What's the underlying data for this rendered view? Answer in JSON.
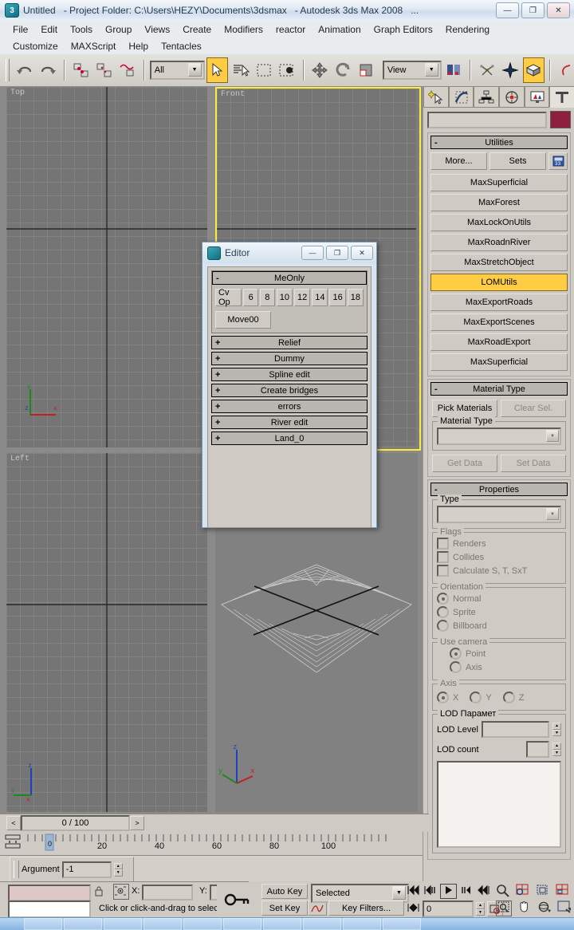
{
  "titlebar": {
    "file_name": "Untitled",
    "project": "- Project Folder: C:\\Users\\HEZY\\Documents\\3dsmax",
    "app": "- Autodesk 3ds Max 2008",
    "ellipsis": "...",
    "minimize": "—",
    "restore": "❐",
    "close": "✕"
  },
  "menu": {
    "row1": [
      "File",
      "Edit",
      "Tools",
      "Group",
      "Views",
      "Create",
      "Modifiers",
      "reactor",
      "Animation",
      "Graph Editors",
      "Rendering"
    ],
    "row2": [
      "Customize",
      "MAXScript",
      "Help",
      "Tentacles"
    ]
  },
  "toolbar": {
    "selection_filter": "All",
    "reference_coord": "View",
    "icons": [
      "undo-icon",
      "redo-icon",
      "select-link-icon",
      "unlink-icon",
      "bind-space-warp-icon",
      "select-object-icon",
      "select-by-name-icon",
      "rect-select-region-icon",
      "window-crossing-icon",
      "select-move-icon",
      "select-rotate-icon",
      "select-scale-icon",
      "use-pivot-center-icon",
      "mirror-icon",
      "align-icon",
      "layer-manager-icon",
      "curve-editor-icon"
    ]
  },
  "viewports": [
    {
      "label": "Top",
      "active": false
    },
    {
      "label": "Front",
      "active": true
    },
    {
      "label": "Left",
      "active": false
    },
    {
      "label": "",
      "active": false
    }
  ],
  "editor_dialog": {
    "title": "Editor",
    "minimize": "—",
    "restore": "❐",
    "close": "✕",
    "rollup_open": {
      "label": "MeOnly",
      "sign": "-",
      "buttons": [
        "Cv Op",
        "6",
        "8",
        "10",
        "12",
        "14",
        "16",
        "18"
      ],
      "move_button": "Move00"
    },
    "rollups": [
      {
        "sign": "+",
        "label": "Relief"
      },
      {
        "sign": "+",
        "label": "Dummy"
      },
      {
        "sign": "+",
        "label": "Spline edit"
      },
      {
        "sign": "+",
        "label": "Create bridges"
      },
      {
        "sign": "+",
        "label": "errors"
      },
      {
        "sign": "+",
        "label": "River edit"
      },
      {
        "sign": "+",
        "label": "Land_0"
      }
    ]
  },
  "command_panel": {
    "tabs": [
      "create-tab-icon",
      "modify-tab-icon",
      "hierarchy-tab-icon",
      "motion-tab-icon",
      "display-tab-icon",
      "utilities-tab-icon"
    ],
    "object_name": "",
    "object_color": "#8f1f3f",
    "utilities": {
      "sign": "-",
      "title": "Utilities",
      "more_button": "More...",
      "sets_button": "Sets",
      "config_icon": "configure-button-sets-icon",
      "buttons": [
        {
          "label": "MaxSuperficial",
          "selected": false
        },
        {
          "label": "MaxForest",
          "selected": false
        },
        {
          "label": "MaxLockOnUtils",
          "selected": false
        },
        {
          "label": "MaxRoadnRiver",
          "selected": false
        },
        {
          "label": "MaxStretchObject",
          "selected": false
        },
        {
          "label": "LOMUtils",
          "selected": true
        },
        {
          "label": "MaxExportRoads",
          "selected": false
        },
        {
          "label": "MaxExportScenes",
          "selected": false
        },
        {
          "label": "MaxRoadExport",
          "selected": false
        },
        {
          "label": "MaxSuperficial",
          "selected": false
        }
      ]
    },
    "material_type": {
      "sign": "-",
      "title": "Material Type",
      "pick_materials": "Pick Materials",
      "clear_sel": "Clear Sel.",
      "group_label": "Material Type",
      "combo_value": "",
      "get_data": "Get Data",
      "set_data": "Set Data"
    },
    "properties": {
      "sign": "-",
      "title": "Properties",
      "type_group": "Type",
      "type_value": "",
      "flags_group": "Flags",
      "flags": [
        "Renders",
        "Collides",
        "Calculate S, T, SxT"
      ],
      "orientation_group": "Orientation",
      "orientation": [
        {
          "label": "Normal",
          "checked": true
        },
        {
          "label": "Sprite",
          "checked": false
        },
        {
          "label": "Billboard",
          "checked": false
        }
      ],
      "use_camera_group": "Use camera",
      "use_camera": [
        {
          "label": "Point",
          "checked": true
        },
        {
          "label": "Axis",
          "checked": false
        }
      ],
      "axis_group": "Axis",
      "axis": [
        {
          "label": "X",
          "checked": true
        },
        {
          "label": "Y",
          "checked": false
        },
        {
          "label": "Z",
          "checked": false
        }
      ],
      "lod_group": "LOD Парамет",
      "lod_level_label": "LOD Level",
      "lod_level_value": "",
      "lod_count_label": "LOD count",
      "lod_count_value": ""
    }
  },
  "timeline": {
    "prev_frame": "<",
    "next_frame": ">",
    "frame_display": "0 / 100",
    "ruler_ticks": [
      "20",
      "40",
      "60",
      "80",
      "100"
    ],
    "current_frame_label": "0"
  },
  "argument_box": {
    "label": "Argument",
    "value": "-1"
  },
  "status_bar": {
    "x_label": "X:",
    "x_value": "",
    "y_label": "Y:",
    "y_value": "",
    "prompt": "Click or click-and-drag to select",
    "lock_icon": "selection-lock-icon",
    "abs_rel_icon": "absolute-relative-transform-icon",
    "key_icon": "key-mode-toggle-icon"
  },
  "animation": {
    "auto_key": "Auto Key",
    "set_key": "Set Key",
    "selected_dropdown": "Selected",
    "key_filters": "Key Filters...",
    "current_frame": "0",
    "playback_icons": [
      "go-to-start-icon",
      "previous-frame-icon",
      "play-animation-icon",
      "next-frame-icon",
      "go-to-end-icon"
    ],
    "nav_icons": [
      "zoom-icon",
      "zoom-all-icon",
      "zoom-extents-icon",
      "zoom-extents-all-icon",
      "zoom-region-icon",
      "pan-view-icon",
      "arc-rotate-icon",
      "maximize-viewport-icon"
    ],
    "time_config_icon": "time-configuration-icon"
  },
  "taskbar": {
    "items": [
      "taskbar-item-1",
      "taskbar-item-2",
      "taskbar-item-3",
      "taskbar-item-4",
      "taskbar-item-5",
      "taskbar-item-6",
      "taskbar-item-7",
      "taskbar-item-8",
      "taskbar-item-9",
      "taskbar-item-10"
    ]
  }
}
